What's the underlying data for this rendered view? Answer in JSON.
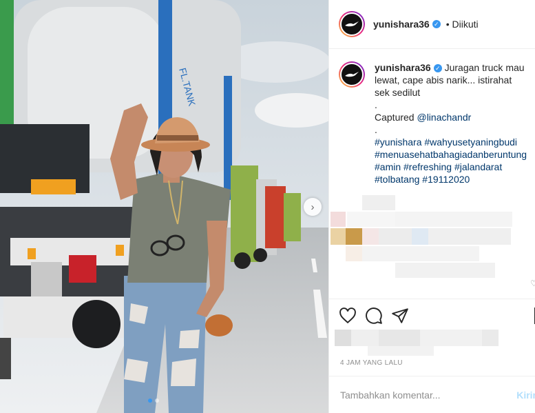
{
  "post": {
    "username": "yunishara36",
    "follow_status": "• Diikuti",
    "caption": {
      "line1": "Juragan truck mau lewat, cape abis narik... istirahat sek sedilut",
      "dot1": ".",
      "captured_label": "Captured",
      "captured_mention": "@linachandr",
      "dot2": ".",
      "hashtags": "#yunishara #wahyusetyaningbudi #menuasehatbahagiadanberuntung #amin #refreshing #jalandarat #tolbatang #19112020"
    },
    "timestamp": "4 JAM YANG LALU",
    "add_comment_placeholder": "Tambahkan komentar...",
    "post_button": "Kirim"
  },
  "carousel": {
    "next_arrow": "›",
    "slide_count": 2,
    "active_slide": 1
  },
  "icons": {
    "avatar": "bird-logo-icon",
    "verified": "verified-badge-icon",
    "like": "heart-icon",
    "comment": "comment-bubble-icon",
    "share": "paper-plane-icon",
    "save": "bookmark-icon"
  },
  "colors": {
    "link": "#00376b",
    "verified": "#3897f0",
    "muted": "#8e8e8e",
    "post_button": "#b2dffc"
  }
}
